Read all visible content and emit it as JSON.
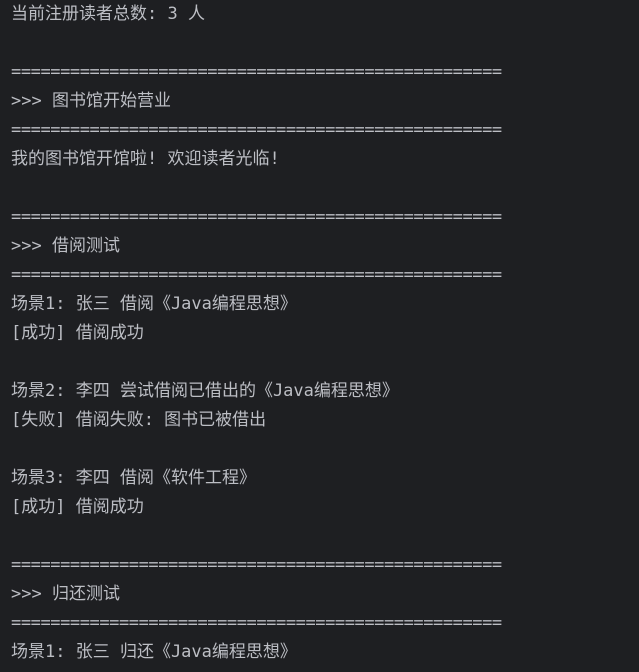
{
  "console": {
    "lines": [
      "当前注册读者总数: 3 人",
      "",
      "==================================================",
      ">>> 图书馆开始营业",
      "==================================================",
      "我的图书馆开馆啦! 欢迎读者光临!",
      "",
      "==================================================",
      ">>> 借阅测试",
      "==================================================",
      "场景1: 张三 借阅《Java编程思想》",
      "[成功] 借阅成功",
      "",
      "场景2: 李四 尝试借阅已借出的《Java编程思想》",
      "[失败] 借阅失败: 图书已被借出",
      "",
      "场景3: 李四 借阅《软件工程》",
      "[成功] 借阅成功",
      "",
      "==================================================",
      ">>> 归还测试",
      "==================================================",
      "场景1: 张三 归还《Java编程思想》"
    ]
  }
}
